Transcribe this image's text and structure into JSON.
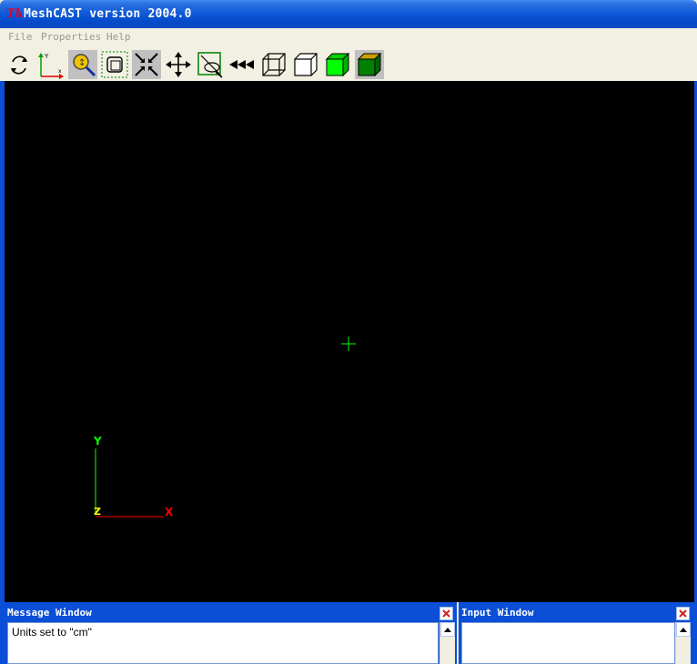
{
  "window": {
    "logo_text": "Tk",
    "title": "MeshCAST version 2004.0"
  },
  "menu": {
    "items": [
      "File",
      "Properties",
      "Help"
    ]
  },
  "toolbar": {
    "buttons": [
      {
        "icon": "rotate-icon",
        "pressed": false
      },
      {
        "icon": "axes-icon",
        "pressed": false
      },
      {
        "icon": "zoom-icon",
        "pressed": true
      },
      {
        "icon": "zoom-box-icon",
        "pressed": false
      },
      {
        "icon": "fit-to-window-icon",
        "pressed": true
      },
      {
        "icon": "pan-icon",
        "pressed": false
      },
      {
        "icon": "pick-icon",
        "pressed": false
      },
      {
        "icon": "rewind-icon",
        "pressed": false
      },
      {
        "icon": "wireframe-cube-icon",
        "pressed": false
      },
      {
        "icon": "hidden-line-cube-icon",
        "pressed": false
      },
      {
        "icon": "shaded-cube-icon",
        "pressed": false
      },
      {
        "icon": "shaded-lit-cube-icon",
        "pressed": true
      }
    ]
  },
  "viewport": {
    "background": "#000000",
    "axis_labels": {
      "y": "Y",
      "z": "Z",
      "x": "X"
    },
    "axis_colors": {
      "x": "#ff0000",
      "y": "#00ff00",
      "z": "#ffff00"
    },
    "cursor_color": "#00ff00"
  },
  "message_window": {
    "title": "Message Window",
    "text": "Units set to \"cm\""
  },
  "input_window": {
    "title": "Input Window",
    "text": ""
  },
  "colors": {
    "title_bar": "#0a55d6",
    "frame": "#0a4fd6",
    "toolbar_bg": "#f2f0e3"
  }
}
